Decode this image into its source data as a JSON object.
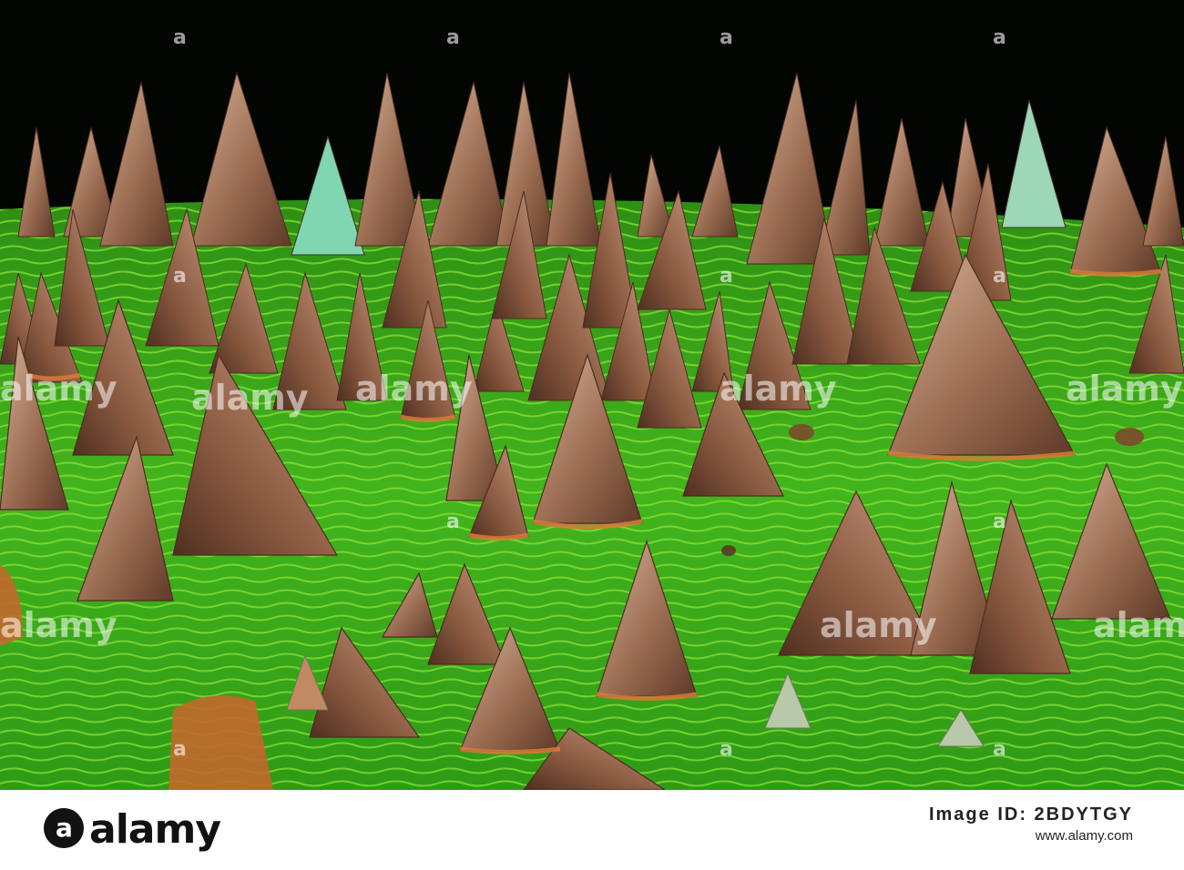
{
  "image": {
    "subject": "thorny-trunk-closeup",
    "colors": {
      "background": "#030503",
      "bark": "#3fb01c",
      "bark_highlight": "#8ee63a",
      "thorn_light": "#c9a58a",
      "thorn_dark": "#6b4632",
      "thorn_rim": "#d97a3a",
      "lichen": "#7fd6b0"
    }
  },
  "watermark": {
    "text": "alamy",
    "color": "#ffffff"
  },
  "footer": {
    "brand": "alamy",
    "brand_mark": "a",
    "image_id_label": "Image ID: 2BDYTGY",
    "site": "www.alamy.com"
  }
}
